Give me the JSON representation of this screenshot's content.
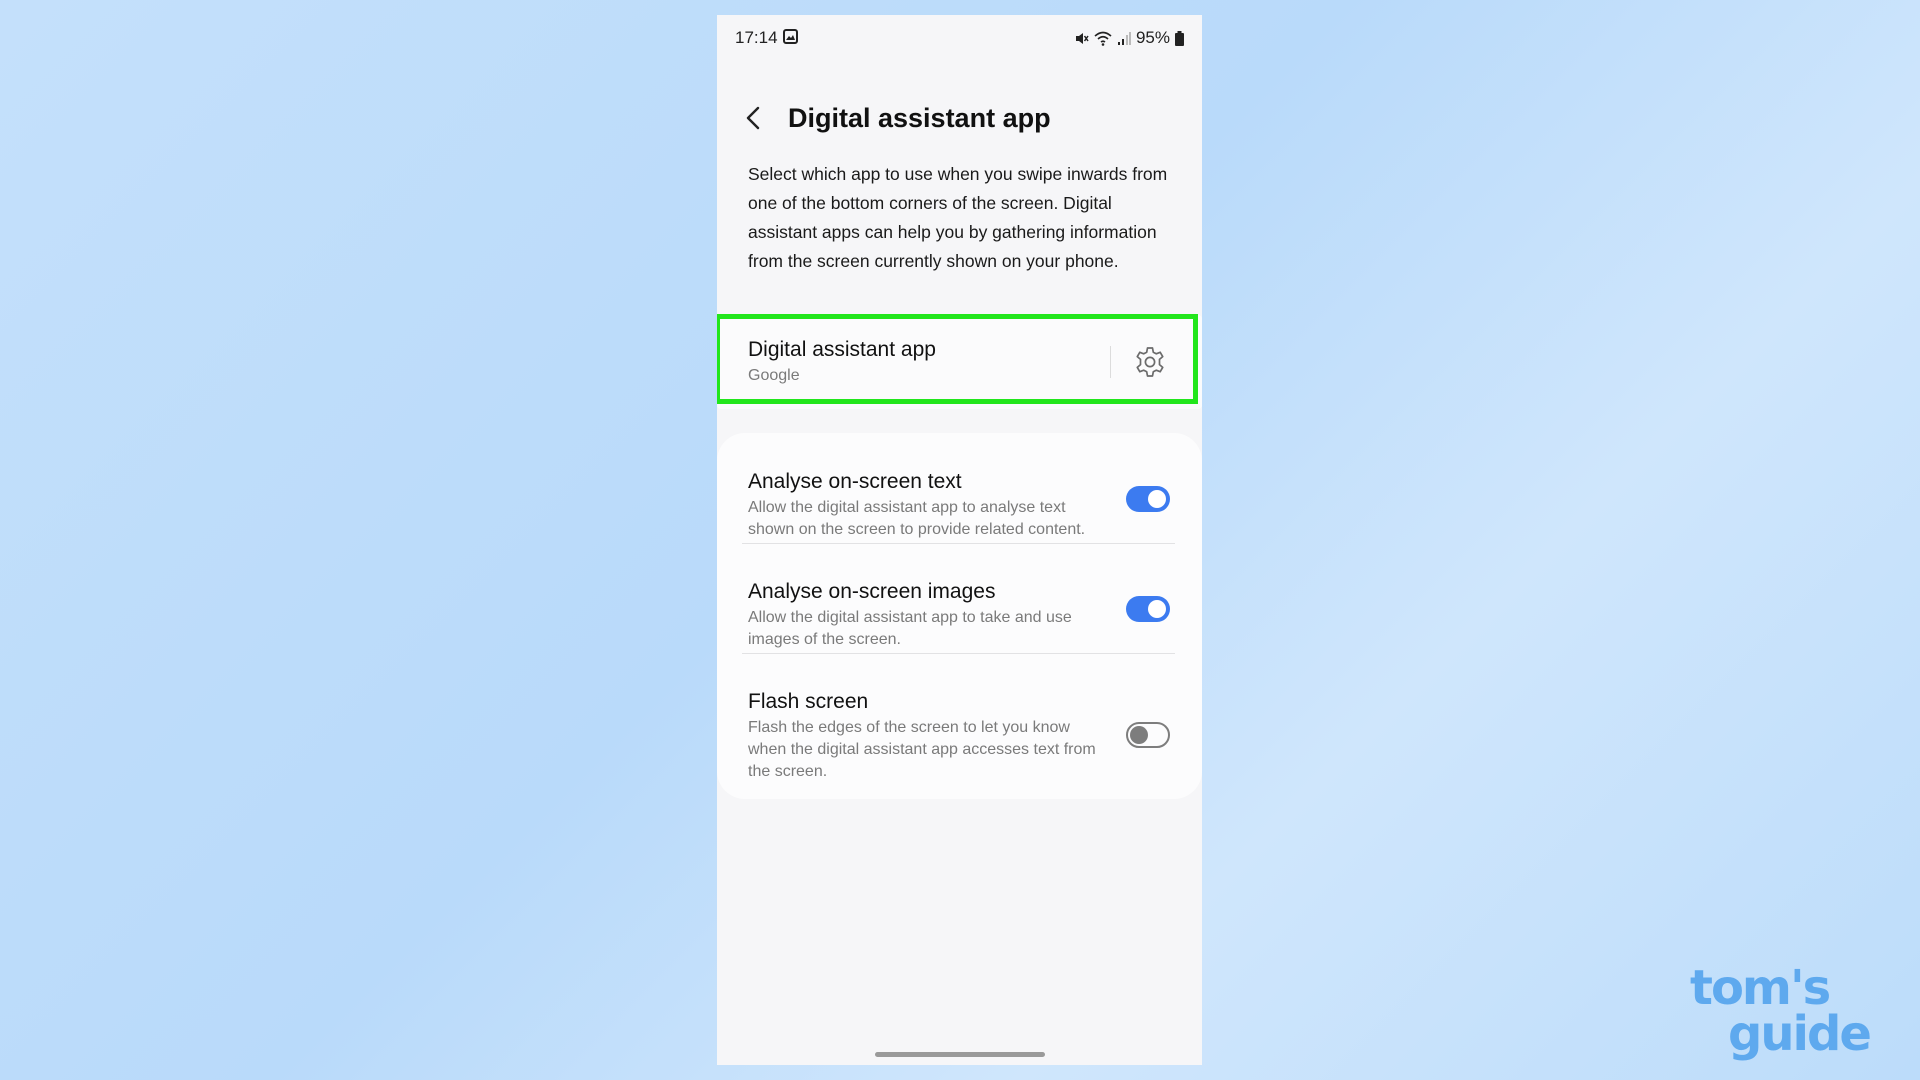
{
  "status_bar": {
    "time": "17:14",
    "battery": "95%",
    "icons": [
      "image-icon",
      "mute-icon",
      "wifi-icon",
      "signal-icon",
      "battery-icon"
    ]
  },
  "header": {
    "title": "Digital assistant app"
  },
  "description": "Select which app to use when you swipe inwards from one of the bottom corners of the screen. Digital assistant apps can help you by gathering information from the screen currently shown on your phone.",
  "assistant_setting": {
    "title": "Digital assistant app",
    "value": "Google",
    "highlight_color": "#22e61c"
  },
  "toggles": [
    {
      "title": "Analyse on-screen text",
      "description": "Allow the digital assistant app to analyse text shown on the screen to provide related content.",
      "enabled": true
    },
    {
      "title": "Analyse on-screen images",
      "description": "Allow the digital assistant app to take and use images of the screen.",
      "enabled": true
    },
    {
      "title": "Flash screen",
      "description": "Flash the edges of the screen to let you know when the digital assistant app accesses text from the screen.",
      "enabled": false
    }
  ],
  "watermark": {
    "line1": "tom's",
    "line2": "guide"
  },
  "colors": {
    "accent": "#3c7bf0",
    "background": "#c4e0fb",
    "watermark": "#5ea9ee"
  }
}
